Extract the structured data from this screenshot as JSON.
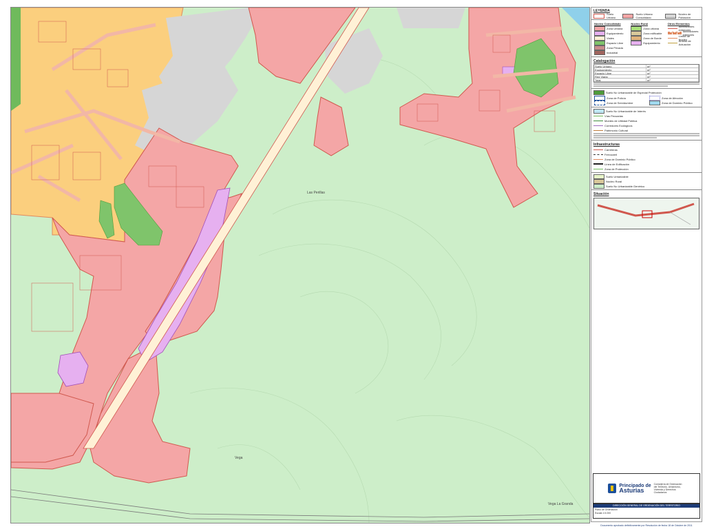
{
  "map": {
    "colors": {
      "suelo_no_urbanizable": "#cdeec9",
      "suelo_urbano": "#f4a6a6",
      "suelo_urbano_orange": "#fbcf7e",
      "no_ocupado": "#d6d6d6",
      "equipamiento": "#e6b0f0",
      "espacio_libre": "#7fc46b",
      "carretera": "#fff1d6",
      "agua": "#8fd0ea"
    },
    "place_labels": [
      "Las Perillas",
      "Vega",
      "Vega La Granda"
    ]
  },
  "legend": {
    "header": "LEYENDA",
    "clase": [
      "Suelo Urbano",
      "Suelo Urbano Consolidado",
      "Núcleo de Población"
    ],
    "col_titles": [
      "Núcleo Consolidado",
      "Núcleo Rural",
      "Otros Elementos"
    ],
    "col1": [
      "Zona Urbana",
      "Equipamiento",
      "Viales",
      "Espacio Libre",
      "Zona Privada",
      "Industrial"
    ],
    "col2": [
      "Zona urbana",
      "Zona edificable",
      "Zona de Borde",
      "Equipamiento"
    ],
    "col3": [
      "Alineaciones exteriores",
      "Alineaciones interiores",
      "Límite de Núcleo",
      "Ámbito de Actuación"
    ],
    "cat_title": "Catalogación",
    "cat_rows": [
      [
        "Suelo Urbano",
        "m²"
      ],
      [
        "Equipamiento",
        "m²"
      ],
      [
        "Espacio Libre",
        "m²"
      ],
      [
        "Red Viaria",
        "m²"
      ],
      [
        "Total",
        "m²"
      ]
    ],
    "snu_title": "Suelo No Urbanizable de Especial Protección",
    "snu_items": [
      "Zona de Policía",
      "Zona de Servidumbre",
      "Zona de Afección",
      "Zona de Dominio Público"
    ],
    "prot_title": "Suelo No Urbanizable de Interés",
    "prot_items": [
      "Vías Pecuarias",
      "Montes de Utilidad Pública",
      "Corredores Ecológicos",
      "Patrimonio Cultural"
    ],
    "infra_title": "Infraestructuras",
    "infra_items": [
      "Carreteras",
      "Ferrocarril",
      "Zona de Dominio Público",
      "Línea de Edificación",
      "Zona de Protección"
    ],
    "misc_items": [
      "Suelo Urbanizable",
      "Núcleo Rural",
      "Suelo No Urbanizable Genérico"
    ],
    "inset_title": "Situación",
    "brand": {
      "name_top": "Principado de",
      "name_main": "Asturias",
      "dept": "Consejería de Ordenación del Territorio, Urbanismo, Vivienda y Derechos Ciudadanos"
    },
    "title_block": {
      "header": "DIRECCIÓN GENERAL DE ORDENACIÓN DEL TERRITORIO",
      "line1": "Plano de Ordenación",
      "line2": "Escala 1:5.000"
    },
    "footer": "Documento aprobado definitivamente por Resolución de fecha 18 de Octubre de 2011"
  }
}
